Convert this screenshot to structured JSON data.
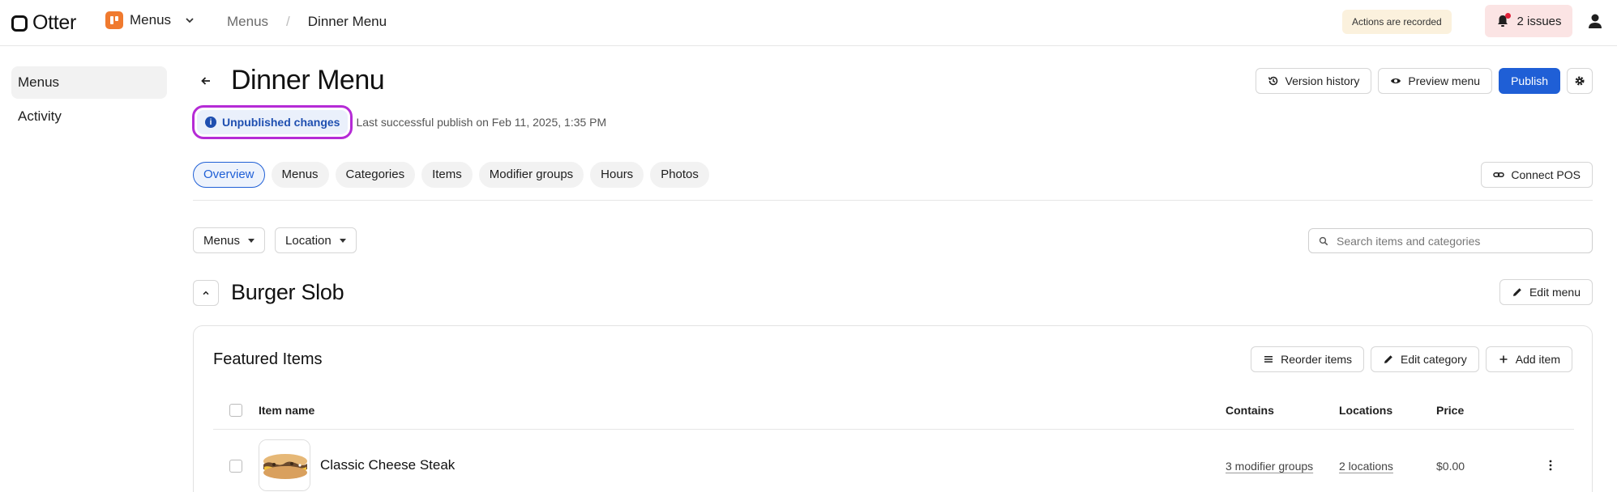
{
  "topbar": {
    "brand": "Otter",
    "app_name": "Menus",
    "breadcrumb_root": "Menus",
    "breadcrumb_separator": "/",
    "breadcrumb_current": "Dinner Menu",
    "recorded_notice": "Actions are recorded",
    "issues_label": "2 issues"
  },
  "sidebar": {
    "items": [
      {
        "label": "Menus"
      },
      {
        "label": "Activity"
      }
    ]
  },
  "header": {
    "title": "Dinner Menu",
    "version_history": "Version history",
    "preview_menu": "Preview menu",
    "publish": "Publish",
    "status_badge": "Unpublished changes",
    "last_publish": "Last successful publish on Feb 11, 2025, 1:35 PM"
  },
  "tabs": [
    {
      "label": "Overview"
    },
    {
      "label": "Menus"
    },
    {
      "label": "Categories"
    },
    {
      "label": "Items"
    },
    {
      "label": "Modifier groups"
    },
    {
      "label": "Hours"
    },
    {
      "label": "Photos"
    }
  ],
  "connect_pos": "Connect POS",
  "filters": {
    "menus": "Menus",
    "location": "Location",
    "search_placeholder": "Search items and categories"
  },
  "menu_section": {
    "name": "Burger Slob",
    "edit_menu": "Edit menu"
  },
  "category": {
    "title": "Featured Items",
    "reorder": "Reorder items",
    "edit_category": "Edit category",
    "add_item": "Add item",
    "columns": {
      "item_name": "Item name",
      "contains": "Contains",
      "locations": "Locations",
      "price": "Price"
    },
    "rows": [
      {
        "name": "Classic Cheese Steak",
        "contains": "3 modifier groups",
        "locations": "2 locations",
        "price": "$0.00"
      }
    ]
  },
  "colors": {
    "primary": "#1f5fd6",
    "highlight_ring": "#b52bd6",
    "app_icon": "#f07a2f",
    "recorded_bg": "#fbf1dd",
    "issues_bg": "#fbe4e4"
  }
}
